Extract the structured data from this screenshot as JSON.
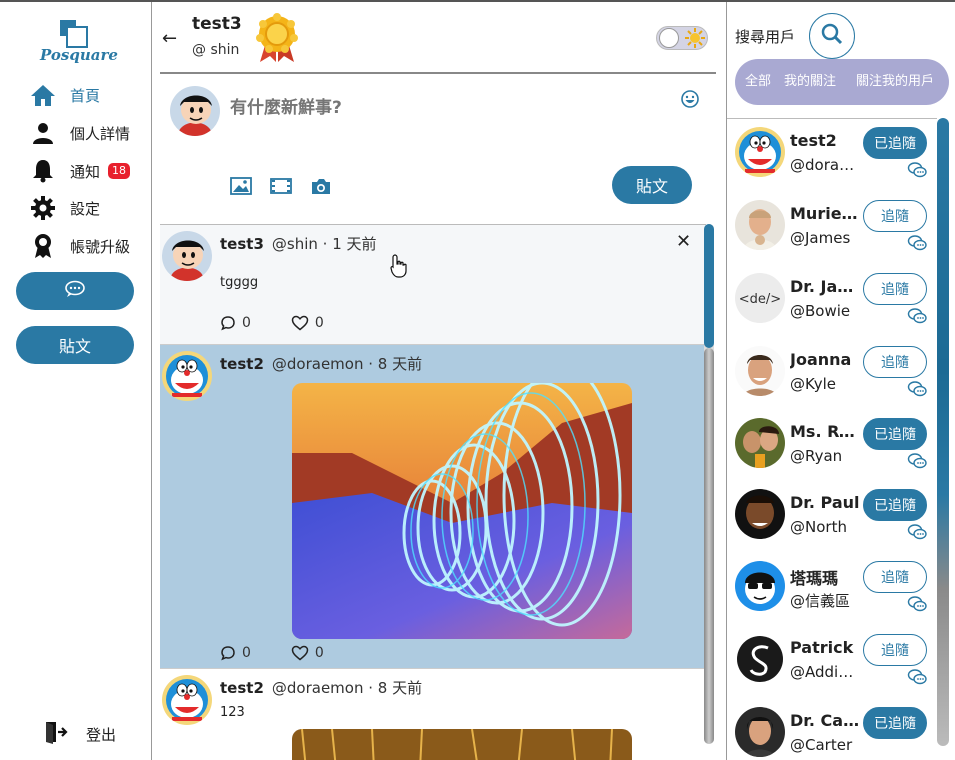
{
  "app": {
    "logo_text": "Posquare",
    "brand_color": "#2a79a4"
  },
  "sidebar": {
    "items": [
      {
        "label": "首頁",
        "icon": "home-icon",
        "active": true
      },
      {
        "label": "個人詳情",
        "icon": "user-icon"
      },
      {
        "label": "通知",
        "icon": "bell-icon",
        "badge": "18"
      },
      {
        "label": "設定",
        "icon": "gear-icon"
      },
      {
        "label": "帳號升級",
        "icon": "ribbon-icon"
      }
    ],
    "chat_icon": "chat-icon",
    "post_label": "貼文",
    "logout_label": "登出"
  },
  "header": {
    "username": "test3",
    "handle": "@ shin",
    "back_icon": "←"
  },
  "composer": {
    "placeholder": "有什麼新鮮事?",
    "post_label": "貼文"
  },
  "feed": {
    "posts": [
      {
        "name": "test3",
        "meta": "@shin · 1 天前",
        "text": "tgggg",
        "comments": "0",
        "likes": "0",
        "close": "✕"
      },
      {
        "name": "test2",
        "meta": "@doraemon · 8 天前",
        "text": "",
        "comments": "0",
        "likes": "0"
      },
      {
        "name": "test2",
        "meta": "@doraemon · 8 天前",
        "text": "123"
      }
    ]
  },
  "right": {
    "search_label": "搜尋用戶",
    "tabs": [
      "全部",
      "我的關注",
      "關注我的用戶"
    ],
    "users": [
      {
        "name": "test2",
        "handle": "@doraemon",
        "follow": "已追隨",
        "following": true
      },
      {
        "name": "Muriel Hoffman",
        "handle": "@James",
        "follow": "追隨",
        "following": false
      },
      {
        "name": "Dr. James",
        "handle": "@Bowie",
        "follow": "追隨",
        "following": false
      },
      {
        "name": "Joanna",
        "handle": "@Kyle",
        "follow": "追隨",
        "following": false
      },
      {
        "name": "Ms. Ryan",
        "handle": "@Ryan",
        "follow": "已追隨",
        "following": true
      },
      {
        "name": "Dr. Paul",
        "handle": "@North",
        "follow": "已追隨",
        "following": true
      },
      {
        "name": "塔瑪瑪",
        "handle": "@信義區",
        "follow": "追隨",
        "following": false
      },
      {
        "name": "Patrick",
        "handle": "@Addison",
        "follow": "追隨",
        "following": false
      },
      {
        "name": "Dr. Carter",
        "handle": "@Carter",
        "follow": "已追隨",
        "following": true
      }
    ]
  }
}
